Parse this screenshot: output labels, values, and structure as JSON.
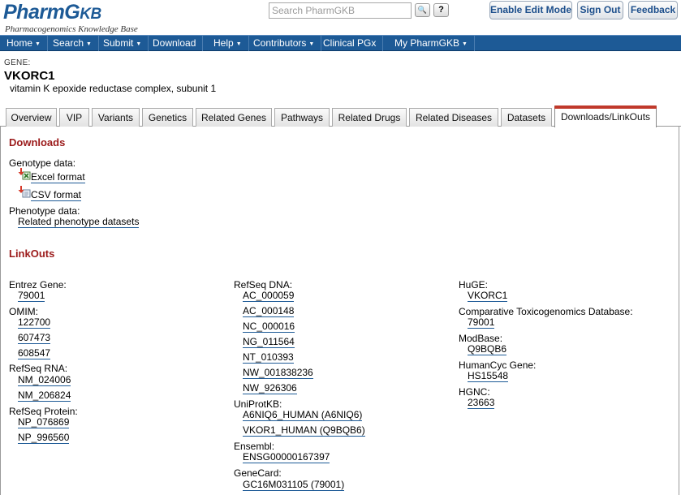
{
  "header": {
    "logo_main": "PharmG",
    "logo_kb": "KB",
    "logo_sub": "Pharmacogenomics Knowledge Base",
    "search_placeholder": "Search PharmGKB",
    "search_btn": "🔍",
    "help_btn": "?",
    "buttons": [
      "Enable Edit Mode",
      "Sign Out",
      "Feedback"
    ]
  },
  "nav": [
    {
      "label": "Home",
      "caret": "▼"
    },
    {
      "label": "Search",
      "caret": "▼"
    },
    {
      "label": "Submit",
      "caret": "▼"
    },
    {
      "label": "Download",
      "caret": ""
    },
    {
      "label": "Help",
      "caret": "▼"
    },
    {
      "label": "Contributors",
      "caret": "▼"
    },
    {
      "label": "Clinical PGx",
      "caret": ""
    },
    {
      "label": "My PharmGKB",
      "caret": "▼"
    }
  ],
  "gene": {
    "label": "GENE:",
    "symbol": "VKORC1",
    "name": "vitamin K epoxide reductase complex, subunit 1"
  },
  "tabs": [
    "Overview",
    "VIP",
    "Variants",
    "Genetics",
    "Related Genes",
    "Pathways",
    "Related Drugs",
    "Related Diseases",
    "Datasets",
    "Downloads/LinkOuts"
  ],
  "active_tab": "Downloads/LinkOuts",
  "downloads": {
    "heading": "Downloads",
    "genotype_label": "Genotype data:",
    "excel": "Excel format",
    "csv": "CSV format",
    "phenotype_label": "Phenotype data:",
    "phenotype_link": "Related phenotype datasets"
  },
  "linkouts": {
    "heading": "LinkOuts",
    "col1": {
      "entrez_label": "Entrez Gene:",
      "entrez": [
        "79001"
      ],
      "omim_label": "OMIM:",
      "omim": [
        "122700",
        "607473",
        "608547"
      ],
      "refseq_rna_label": "RefSeq RNA:",
      "refseq_rna": [
        "NM_024006",
        "NM_206824"
      ],
      "refseq_protein_label": "RefSeq Protein:",
      "refseq_protein": [
        "NP_076869",
        "NP_996560"
      ]
    },
    "col2": {
      "refseq_dna_label": "RefSeq DNA:",
      "refseq_dna": [
        "AC_000059",
        "AC_000148",
        "NC_000016",
        "NG_011564",
        "NT_010393",
        "NW_001838236",
        "NW_926306"
      ],
      "uniprot_label": "UniProtKB:",
      "uniprot": [
        "A6NIQ6_HUMAN (A6NIQ6)",
        "VKOR1_HUMAN (Q9BQB6)"
      ],
      "ensembl_label": "Ensembl:",
      "ensembl": [
        "ENSG00000167397"
      ],
      "genecard_label": "GeneCard:",
      "genecard": [
        "GC16M031105 (79001)"
      ]
    },
    "col3": {
      "huge_label": "HuGE:",
      "huge": [
        "VKORC1"
      ],
      "ctd_label": "Comparative Toxicogenomics Database:",
      "ctd": [
        "79001"
      ],
      "modbase_label": "ModBase:",
      "modbase": [
        "Q9BQB6"
      ],
      "humancyc_label": "HumanCyc Gene:",
      "humancyc": [
        "HS15548"
      ],
      "hgnc_label": "HGNC:",
      "hgnc": [
        "23663"
      ]
    }
  },
  "colors": {
    "brand_blue": "#1d5a96",
    "section_red": "#9b1a1a",
    "tab_accent": "#c0392b"
  }
}
